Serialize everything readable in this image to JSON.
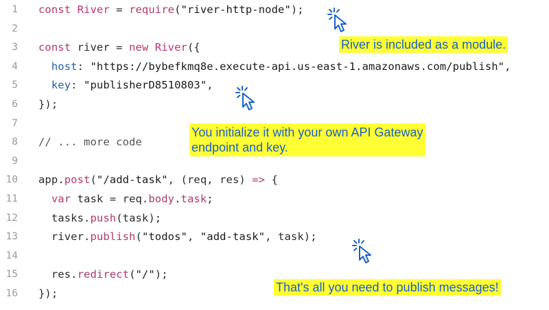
{
  "code": {
    "lines": [
      {
        "n": "1",
        "t": [
          [
            "kw",
            "const "
          ],
          [
            "cls",
            "River"
          ],
          [
            "fn",
            " = "
          ],
          [
            "kw",
            "require"
          ],
          [
            "fn",
            "("
          ],
          [
            "str",
            "\"river-http-node\""
          ],
          [
            "fn",
            ");"
          ]
        ]
      },
      {
        "n": "2",
        "t": []
      },
      {
        "n": "3",
        "t": [
          [
            "kw",
            "const "
          ],
          [
            "fn",
            "river = "
          ],
          [
            "kw",
            "new "
          ],
          [
            "cls",
            "River"
          ],
          [
            "fn",
            "({"
          ]
        ]
      },
      {
        "n": "4",
        "t": [
          [
            "fn",
            "  "
          ],
          [
            "prop",
            "host"
          ],
          [
            "fn",
            ": "
          ],
          [
            "str",
            "\"https://bybefkmq8e.execute-api.us-east-1.amazonaws.com/publish\""
          ],
          [
            "fn",
            ","
          ]
        ]
      },
      {
        "n": "5",
        "t": [
          [
            "fn",
            "  "
          ],
          [
            "prop",
            "key"
          ],
          [
            "fn",
            ": "
          ],
          [
            "str",
            "\"publisherD8510803\""
          ],
          [
            "fn",
            ","
          ]
        ]
      },
      {
        "n": "6",
        "t": [
          [
            "fn",
            "});"
          ]
        ]
      },
      {
        "n": "7",
        "t": []
      },
      {
        "n": "8",
        "t": [
          [
            "cmt",
            "// ... more code"
          ]
        ]
      },
      {
        "n": "9",
        "t": []
      },
      {
        "n": "10",
        "t": [
          [
            "fn",
            "app."
          ],
          [
            "kw",
            "post"
          ],
          [
            "fn",
            "("
          ],
          [
            "str",
            "\"/add-task\""
          ],
          [
            "fn",
            ", (req, res) "
          ],
          [
            "kw",
            "=>"
          ],
          [
            "fn",
            " {"
          ]
        ]
      },
      {
        "n": "11",
        "t": [
          [
            "fn",
            "  "
          ],
          [
            "kw",
            "var "
          ],
          [
            "fn",
            "task = req."
          ],
          [
            "kw",
            "body"
          ],
          [
            "fn",
            "."
          ],
          [
            "kw",
            "task"
          ],
          [
            "fn",
            ";"
          ]
        ]
      },
      {
        "n": "12",
        "t": [
          [
            "fn",
            "  tasks."
          ],
          [
            "kw",
            "push"
          ],
          [
            "fn",
            "(task);"
          ]
        ]
      },
      {
        "n": "13",
        "t": [
          [
            "fn",
            "  river."
          ],
          [
            "kw",
            "publish"
          ],
          [
            "fn",
            "("
          ],
          [
            "str",
            "\"todos\""
          ],
          [
            "fn",
            ", "
          ],
          [
            "str",
            "\"add-task\""
          ],
          [
            "fn",
            ", task);"
          ]
        ]
      },
      {
        "n": "14",
        "t": []
      },
      {
        "n": "15",
        "t": [
          [
            "fn",
            "  res."
          ],
          [
            "kw",
            "redirect"
          ],
          [
            "fn",
            "("
          ],
          [
            "str",
            "\"/\""
          ],
          [
            "fn",
            ");"
          ]
        ]
      },
      {
        "n": "16",
        "t": [
          [
            "fn",
            "});"
          ]
        ]
      }
    ]
  },
  "annotations": {
    "module": "River is included as a module.",
    "init_line1": "You initialize it with your own API Gateway",
    "init_line2": "endpoint and key.",
    "publish": "That's all you need to publish messages!"
  },
  "colors": {
    "highlight": "#ffff33",
    "annotation_text": "#1a5fc8",
    "cursor": "#1a5fc8"
  },
  "icons": [
    "click-cursor-icon"
  ]
}
